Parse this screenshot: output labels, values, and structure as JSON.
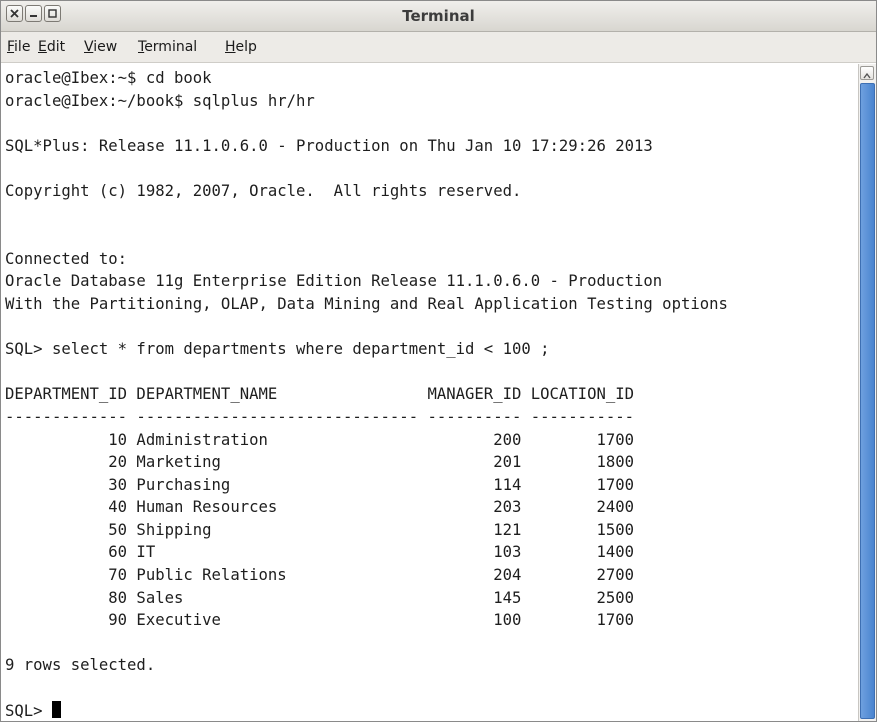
{
  "window": {
    "title": "Terminal",
    "buttons": {
      "close": "close-icon",
      "minimize": "minimize-icon",
      "maximize": "maximize-icon"
    }
  },
  "menu": [
    {
      "mnemonic": "F",
      "rest": "ile"
    },
    {
      "mnemonic": "E",
      "rest": "dit"
    },
    {
      "mnemonic": "V",
      "rest": "iew"
    },
    {
      "mnemonic": "T",
      "rest": "erminal"
    },
    {
      "mnemonic": "H",
      "rest": "elp"
    }
  ],
  "terminal": {
    "lines": [
      "oracle@Ibex:~$ cd book",
      "oracle@Ibex:~/book$ sqlplus hr/hr",
      "",
      "SQL*Plus: Release 11.1.0.6.0 - Production on Thu Jan 10 17:29:26 2013",
      "",
      "Copyright (c) 1982, 2007, Oracle.  All rights reserved.",
      "",
      "",
      "Connected to:",
      "Oracle Database 11g Enterprise Edition Release 11.1.0.6.0 - Production",
      "With the Partitioning, OLAP, Data Mining and Real Application Testing options",
      "",
      "SQL> select * from departments where department_id < 100 ;",
      "",
      "DEPARTMENT_ID DEPARTMENT_NAME                MANAGER_ID LOCATION_ID",
      "------------- ------------------------------ ---------- -----------",
      "           10 Administration                        200        1700",
      "           20 Marketing                             201        1800",
      "           30 Purchasing                            114        1700",
      "           40 Human Resources                       203        2400",
      "           50 Shipping                              121        1500",
      "           60 IT                                    103        1400",
      "           70 Public Relations                      204        2700",
      "           80 Sales                                 145        2500",
      "           90 Executive                             100        1700",
      "",
      "9 rows selected.",
      ""
    ],
    "prompt": "SQL> "
  },
  "colors": {
    "text": "#1e1e1e",
    "scroll_thumb": "#4a84cf"
  }
}
